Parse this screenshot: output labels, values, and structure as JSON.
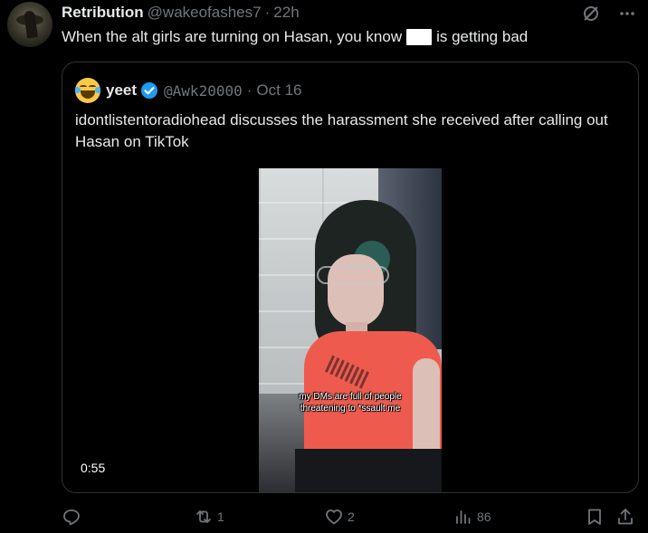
{
  "tweet": {
    "author_name": "Retribution",
    "author_handle": "@wakeofashes7",
    "separator": "·",
    "time": "22h",
    "text_before": "When the alt girls are turning on Hasan, you know",
    "text_after": "is getting bad"
  },
  "quote": {
    "author_name": "yeet",
    "author_handle": "@Awk20000",
    "separator": "·",
    "date": "Oct 16",
    "text": "idontlistentoradiohead discusses the harassment she received after calling out Hasan on TikTok",
    "video": {
      "caption_line1": "my DMs are full of people",
      "caption_line2": "threatening to *ssault me",
      "duration": "0:55"
    }
  },
  "actions": {
    "reply_count": "",
    "retweet_count": "1",
    "like_count": "2",
    "views_count": "86"
  },
  "colors": {
    "background": "#000000",
    "text": "#e7e9ea",
    "muted": "#71767b",
    "border": "#2f3336",
    "verified": "#1d9bf0"
  },
  "icons": [
    "grok-icon",
    "more-icon",
    "verified-icon",
    "reply-icon",
    "retweet-icon",
    "like-icon",
    "views-icon",
    "bookmark-icon",
    "share-icon"
  ]
}
